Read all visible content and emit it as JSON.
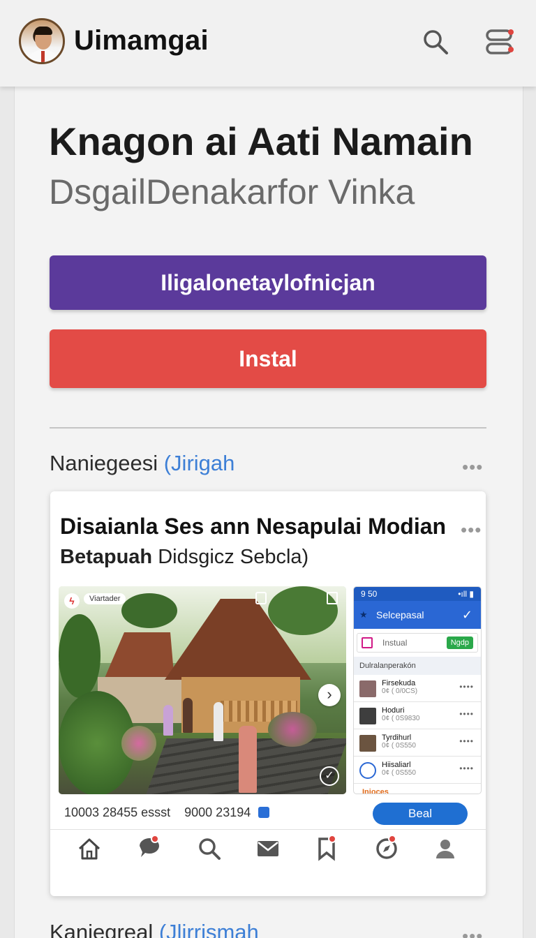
{
  "header": {
    "app_title": "Uimamgai",
    "icons": [
      "avatar",
      "search-icon",
      "menu-icon"
    ]
  },
  "hero": {
    "heading": "Knagon ai Aati Namain",
    "subheading": "DsgailDenakarfor Vinka"
  },
  "buttons": {
    "primary_label": "Iligalonetaylofnicjan",
    "install_label": "Instal"
  },
  "section1": {
    "title": "Naniegeesi",
    "accent": "(Jirigah",
    "more": "•••"
  },
  "card": {
    "title": "Disaianla Ses ann Nesapulai Modian",
    "subtitle_bold": "Betapuah",
    "subtitle_rest": "Didsgicz Sebcla)",
    "more": "•••",
    "photo_tag": "Viartader",
    "stats_left": "10003 28455 essst",
    "stats_right": "9000 23194",
    "action_label": "Beal"
  },
  "phone": {
    "status_left": "9 50",
    "status_right": "•ıll ▮",
    "appbar_title": "Selcepasal",
    "install_text": "Instual",
    "install_button": "Ngdp",
    "list_header": "Dulralanperakón",
    "rows": [
      {
        "name": "Firsekuda",
        "meta": "0¢ ( 0/0CS)"
      },
      {
        "name": "Hoduri",
        "meta": "0¢ ( 0S9830"
      },
      {
        "name": "Tyrdihurl",
        "meta": "0¢ ( 0S550"
      },
      {
        "name": "Hiisaliarl",
        "meta": "0¢ ( 0S550"
      }
    ],
    "footer": "Inioces"
  },
  "section2": {
    "title": "Kaniegreal",
    "accent": "(Jlirrismah",
    "more": "•••"
  },
  "colors": {
    "primary": "#5b3a9b",
    "install": "#e34b46",
    "accent": "#3d7fd6",
    "action": "#1f6fd2"
  }
}
